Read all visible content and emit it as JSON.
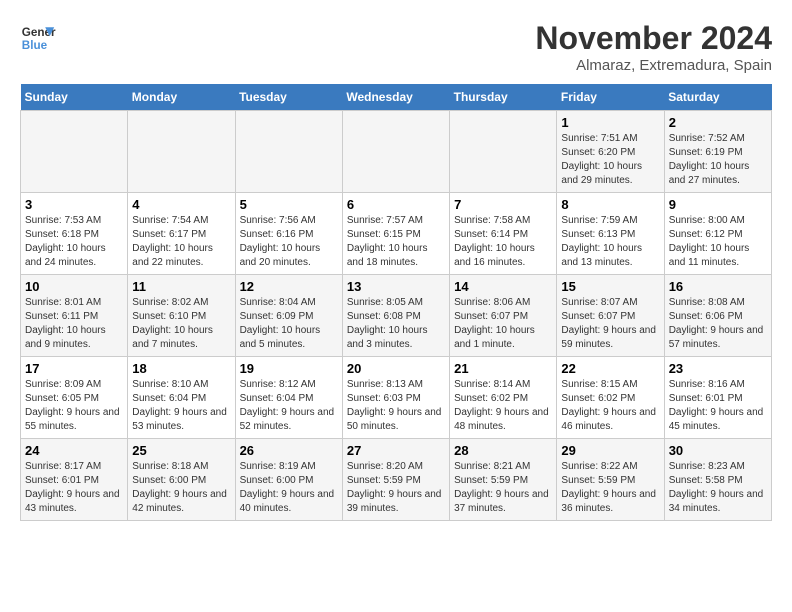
{
  "logo": {
    "line1": "General",
    "line2": "Blue"
  },
  "title": "November 2024",
  "location": "Almaraz, Extremadura, Spain",
  "weekdays": [
    "Sunday",
    "Monday",
    "Tuesday",
    "Wednesday",
    "Thursday",
    "Friday",
    "Saturday"
  ],
  "weeks": [
    [
      {
        "day": "",
        "info": ""
      },
      {
        "day": "",
        "info": ""
      },
      {
        "day": "",
        "info": ""
      },
      {
        "day": "",
        "info": ""
      },
      {
        "day": "",
        "info": ""
      },
      {
        "day": "1",
        "info": "Sunrise: 7:51 AM\nSunset: 6:20 PM\nDaylight: 10 hours and 29 minutes."
      },
      {
        "day": "2",
        "info": "Sunrise: 7:52 AM\nSunset: 6:19 PM\nDaylight: 10 hours and 27 minutes."
      }
    ],
    [
      {
        "day": "3",
        "info": "Sunrise: 7:53 AM\nSunset: 6:18 PM\nDaylight: 10 hours and 24 minutes."
      },
      {
        "day": "4",
        "info": "Sunrise: 7:54 AM\nSunset: 6:17 PM\nDaylight: 10 hours and 22 minutes."
      },
      {
        "day": "5",
        "info": "Sunrise: 7:56 AM\nSunset: 6:16 PM\nDaylight: 10 hours and 20 minutes."
      },
      {
        "day": "6",
        "info": "Sunrise: 7:57 AM\nSunset: 6:15 PM\nDaylight: 10 hours and 18 minutes."
      },
      {
        "day": "7",
        "info": "Sunrise: 7:58 AM\nSunset: 6:14 PM\nDaylight: 10 hours and 16 minutes."
      },
      {
        "day": "8",
        "info": "Sunrise: 7:59 AM\nSunset: 6:13 PM\nDaylight: 10 hours and 13 minutes."
      },
      {
        "day": "9",
        "info": "Sunrise: 8:00 AM\nSunset: 6:12 PM\nDaylight: 10 hours and 11 minutes."
      }
    ],
    [
      {
        "day": "10",
        "info": "Sunrise: 8:01 AM\nSunset: 6:11 PM\nDaylight: 10 hours and 9 minutes."
      },
      {
        "day": "11",
        "info": "Sunrise: 8:02 AM\nSunset: 6:10 PM\nDaylight: 10 hours and 7 minutes."
      },
      {
        "day": "12",
        "info": "Sunrise: 8:04 AM\nSunset: 6:09 PM\nDaylight: 10 hours and 5 minutes."
      },
      {
        "day": "13",
        "info": "Sunrise: 8:05 AM\nSunset: 6:08 PM\nDaylight: 10 hours and 3 minutes."
      },
      {
        "day": "14",
        "info": "Sunrise: 8:06 AM\nSunset: 6:07 PM\nDaylight: 10 hours and 1 minute."
      },
      {
        "day": "15",
        "info": "Sunrise: 8:07 AM\nSunset: 6:07 PM\nDaylight: 9 hours and 59 minutes."
      },
      {
        "day": "16",
        "info": "Sunrise: 8:08 AM\nSunset: 6:06 PM\nDaylight: 9 hours and 57 minutes."
      }
    ],
    [
      {
        "day": "17",
        "info": "Sunrise: 8:09 AM\nSunset: 6:05 PM\nDaylight: 9 hours and 55 minutes."
      },
      {
        "day": "18",
        "info": "Sunrise: 8:10 AM\nSunset: 6:04 PM\nDaylight: 9 hours and 53 minutes."
      },
      {
        "day": "19",
        "info": "Sunrise: 8:12 AM\nSunset: 6:04 PM\nDaylight: 9 hours and 52 minutes."
      },
      {
        "day": "20",
        "info": "Sunrise: 8:13 AM\nSunset: 6:03 PM\nDaylight: 9 hours and 50 minutes."
      },
      {
        "day": "21",
        "info": "Sunrise: 8:14 AM\nSunset: 6:02 PM\nDaylight: 9 hours and 48 minutes."
      },
      {
        "day": "22",
        "info": "Sunrise: 8:15 AM\nSunset: 6:02 PM\nDaylight: 9 hours and 46 minutes."
      },
      {
        "day": "23",
        "info": "Sunrise: 8:16 AM\nSunset: 6:01 PM\nDaylight: 9 hours and 45 minutes."
      }
    ],
    [
      {
        "day": "24",
        "info": "Sunrise: 8:17 AM\nSunset: 6:01 PM\nDaylight: 9 hours and 43 minutes."
      },
      {
        "day": "25",
        "info": "Sunrise: 8:18 AM\nSunset: 6:00 PM\nDaylight: 9 hours and 42 minutes."
      },
      {
        "day": "26",
        "info": "Sunrise: 8:19 AM\nSunset: 6:00 PM\nDaylight: 9 hours and 40 minutes."
      },
      {
        "day": "27",
        "info": "Sunrise: 8:20 AM\nSunset: 5:59 PM\nDaylight: 9 hours and 39 minutes."
      },
      {
        "day": "28",
        "info": "Sunrise: 8:21 AM\nSunset: 5:59 PM\nDaylight: 9 hours and 37 minutes."
      },
      {
        "day": "29",
        "info": "Sunrise: 8:22 AM\nSunset: 5:59 PM\nDaylight: 9 hours and 36 minutes."
      },
      {
        "day": "30",
        "info": "Sunrise: 8:23 AM\nSunset: 5:58 PM\nDaylight: 9 hours and 34 minutes."
      }
    ]
  ]
}
